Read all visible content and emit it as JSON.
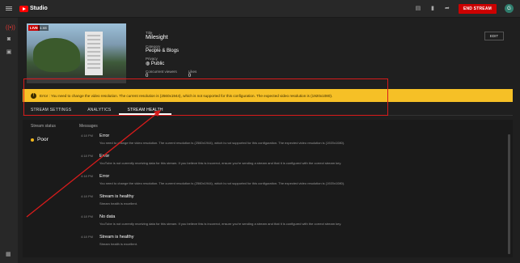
{
  "app": {
    "logo_text": "Studio",
    "end_stream_label": "END STREAM",
    "avatar_letter": "G"
  },
  "stream": {
    "live_badge": "LIVE",
    "elapsed": "1:44",
    "title_label": "Title",
    "title": "Milesight",
    "category_label": "Category",
    "category": "People & Blogs",
    "privacy_label": "Privacy",
    "privacy": "Public",
    "viewers_label": "Concurrent viewers",
    "viewers": "0",
    "likes_label": "Likes",
    "likes": "0",
    "edit_label": "EDIT"
  },
  "banner": {
    "text": "Error : You need to change the video resolution. The current resolution is (2560x1944), which is not supported for this configuration. The expected video resolution is (1920x1080)."
  },
  "tabs": [
    "STREAM SETTINGS",
    "ANALYTICS",
    "STREAM HEALTH"
  ],
  "health": {
    "status_label": "Stream status",
    "status": "Poor",
    "messages_label": "Messages",
    "messages": [
      {
        "time": "4:18 PM",
        "title": "Error",
        "body": "You need to change the video resolution. The current resolution is (2560x1944), which is not supported for this configuration. The expected video resolution is (1920x1080)."
      },
      {
        "time": "4:18 PM",
        "title": "Error",
        "body": "YouTube is not currently receiving data for this stream. If you believe this is incorrect, ensure you're sending a stream and that it is configured with the correct stream key."
      },
      {
        "time": "4:18 PM",
        "title": "Error",
        "body": "You need to change the video resolution. The current resolution is (2560x1944), which is not supported for this configuration. The expected video resolution is (1920x1080)."
      },
      {
        "time": "4:18 PM",
        "title": "Stream is healthy",
        "body": "Stream health is excellent."
      },
      {
        "time": "4:18 PM",
        "title": "No data",
        "body": "YouTube is not currently receiving data for this stream. If you believe this is incorrect, ensure you're sending a stream and that it is configured with the correct stream key."
      },
      {
        "time": "4:18 PM",
        "title": "Stream is healthy",
        "body": "Stream health is excellent."
      }
    ]
  },
  "colors": {
    "banner": "#f6c026",
    "annotation": "#d81b1b",
    "end_stream": "#cc0000",
    "status_dot": "#f2b81c"
  }
}
